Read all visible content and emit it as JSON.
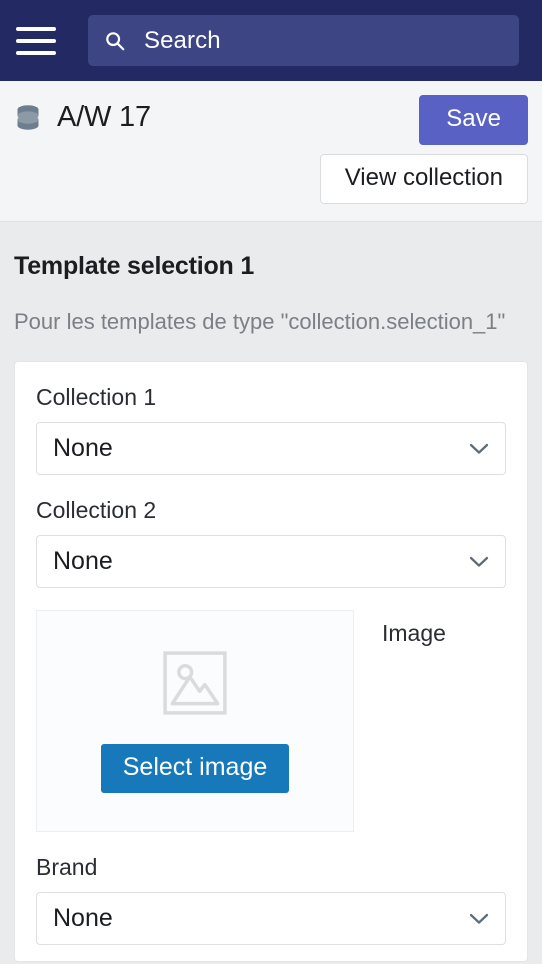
{
  "topbar": {
    "menu_icon": "hamburger-menu-icon",
    "search": {
      "icon": "search-icon",
      "placeholder": "Search",
      "value": ""
    },
    "background_color": "#232a63",
    "search_background_color": "#3e4584"
  },
  "pagehead": {
    "icon": "database-icon",
    "title": "A/W 17",
    "save_label": "Save",
    "save_color": "#5961c4",
    "view_collection_label": "View collection"
  },
  "section": {
    "title": "Template selection 1",
    "subtitle": "Pour les templates de type \"collection.selection_1\""
  },
  "form": {
    "fields": [
      {
        "label": "Collection 1",
        "value": "None",
        "type": "select"
      },
      {
        "label": "Collection 2",
        "value": "None",
        "type": "select"
      }
    ],
    "image": {
      "label": "Image",
      "placeholder_icon": "image-placeholder-icon",
      "button_label": "Select image",
      "button_color": "#1779ba"
    },
    "brand": {
      "label": "Brand",
      "value": "None",
      "type": "select"
    }
  }
}
